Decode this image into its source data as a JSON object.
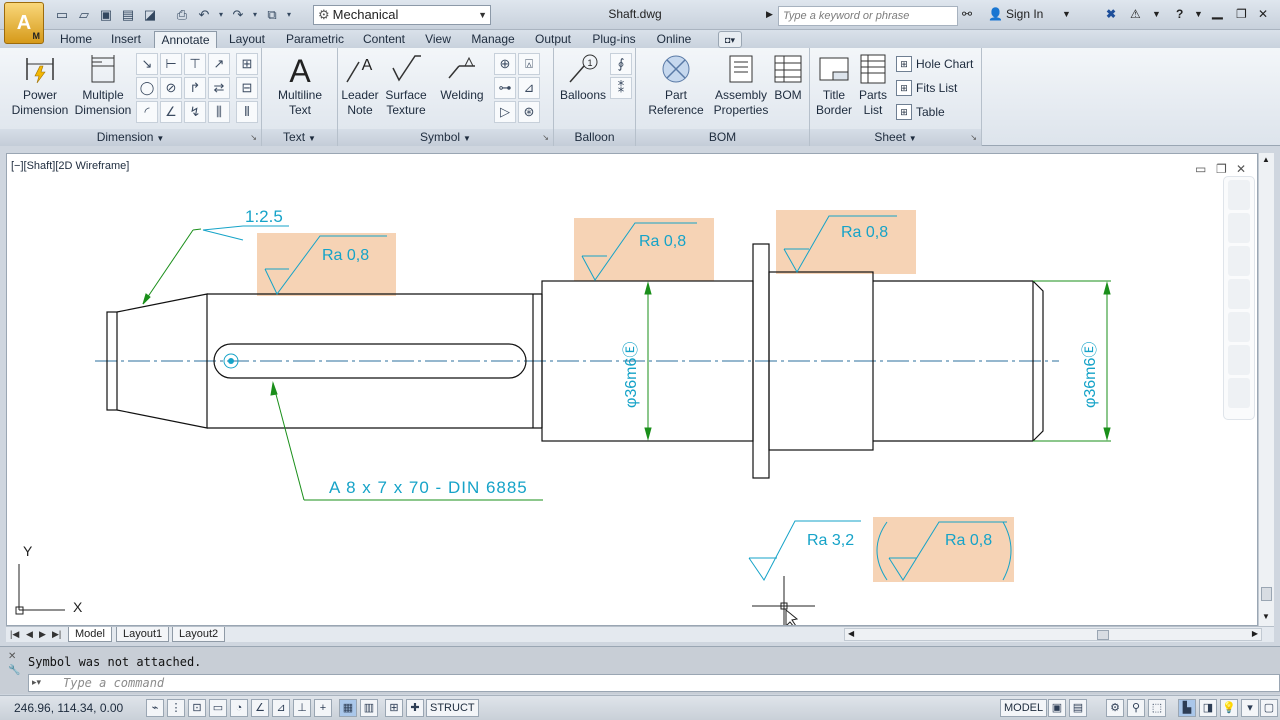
{
  "titlebar": {
    "app_letter": "A",
    "app_sub": "M",
    "workspace": "Mechanical",
    "document_title": "Shaft.dwg",
    "search_placeholder": "Type a keyword or phrase",
    "sign_in": "Sign In",
    "help": "?"
  },
  "ribbon_tabs": [
    "Home",
    "Insert",
    "Annotate",
    "Layout",
    "Parametric",
    "Content",
    "View",
    "Manage",
    "Output",
    "Plug-ins",
    "Online"
  ],
  "active_tab": "Annotate",
  "ribbon": {
    "dimension": {
      "title": "Dimension",
      "power_dimension": [
        "Power",
        "Dimension"
      ],
      "multiple_dimension": [
        "Multiple",
        "Dimension"
      ]
    },
    "text": {
      "title": "Text",
      "multiline_text": [
        "Multiline",
        "Text"
      ]
    },
    "symbol": {
      "title": "Symbol",
      "leader_note": [
        "Leader",
        "Note"
      ],
      "surface_texture": [
        "Surface",
        "Texture"
      ],
      "welding": "Welding"
    },
    "balloon": {
      "title": "Balloon",
      "balloons": "Balloons"
    },
    "bom": {
      "title": "BOM",
      "part_reference": [
        "Part",
        "Reference"
      ],
      "assembly_properties": [
        "Assembly",
        "Properties"
      ],
      "bom": "BOM"
    },
    "sheet": {
      "title": "Sheet",
      "title_border": [
        "Title",
        "Border"
      ],
      "parts_list": [
        "Parts",
        "List"
      ],
      "hole_chart": "Hole Chart",
      "fits_list": "Fits List",
      "table": "Table"
    }
  },
  "viewport": {
    "label": "[−][Shaft][2D Wireframe]"
  },
  "drawing": {
    "taper_label": "1:2.5",
    "roughness_1": "Ra 0,8",
    "roughness_2": "Ra 0,8",
    "roughness_3": "Ra 0,8",
    "roughness_4": "Ra 3,2",
    "roughness_5": "Ra 0,8",
    "diameter_1": "φ36m6Ⓔ",
    "diameter_2": "φ36m6Ⓔ",
    "key_note": "A 8 x 7 x 70 - DIN 6885",
    "ucs_x": "X",
    "ucs_y": "Y"
  },
  "layout_tabs": [
    "Model",
    "Layout1",
    "Layout2"
  ],
  "command": {
    "history": "Symbol was not attached.",
    "placeholder": "Type a command"
  },
  "status": {
    "coordinates": "246.96, 114.34, 0.00",
    "struct": "STRUCT",
    "model": "MODEL"
  },
  "colors": {
    "annotation": "#16a3c8",
    "leader": "#1a8f1a",
    "highlight": "#f6d3b5",
    "centerline": "#2b6f9e"
  }
}
